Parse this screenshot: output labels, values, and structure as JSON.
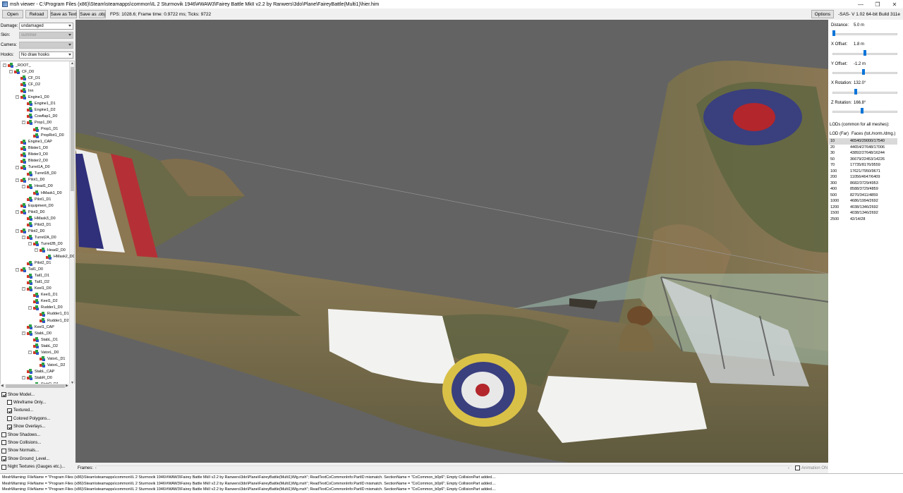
{
  "window": {
    "title": "msh viewer - C:\\Program Files (x86)\\Steam\\steamapps\\common\\IL 2 Sturmovik 1946\\#WAW3\\Fairey Battle MkII v2.2 by Ranwers\\3do\\Plane\\FaireyBattle(Multi1)\\hier.him",
    "min_icon": "minimize-icon",
    "max_icon": "maximize-icon",
    "close_icon": "close-icon"
  },
  "toolbar": {
    "open": "Open",
    "reload": "Reload",
    "save_text": "Save as Text",
    "save_obj": "Save as .obj",
    "stats": "FPS: 1028.6; Frame time: 0.9722 ms; Ticks: 9722",
    "options": "Options",
    "version": "-SAS-  V 1.02  64-bit  Build 311e"
  },
  "left": {
    "damage_label": "Damage:",
    "damage_value": "undamaged",
    "skin_label": "Skin:",
    "skin_value": "summer",
    "camera_label": "Camera:",
    "camera_value": "",
    "hooks_label": "Hooks:",
    "hooks_value": "No draw hooks"
  },
  "tree": [
    {
      "label": "_ROOT_",
      "depth": 0,
      "exp": "-"
    },
    {
      "label": "CF_D0",
      "depth": 1,
      "exp": "-"
    },
    {
      "label": "CF_D1",
      "depth": 2,
      "exp": ""
    },
    {
      "label": "CF_D2",
      "depth": 2,
      "exp": ""
    },
    {
      "label": "Inn",
      "depth": 2,
      "exp": ""
    },
    {
      "label": "Engine1_D0",
      "depth": 2,
      "exp": "-"
    },
    {
      "label": "Engine1_D1",
      "depth": 3,
      "exp": ""
    },
    {
      "label": "Engine1_D2",
      "depth": 3,
      "exp": ""
    },
    {
      "label": "Cowflap1_D0",
      "depth": 3,
      "exp": ""
    },
    {
      "label": "Prop1_D0",
      "depth": 3,
      "exp": "-"
    },
    {
      "label": "Prop1_D1",
      "depth": 4,
      "exp": ""
    },
    {
      "label": "PropRot1_D0",
      "depth": 4,
      "exp": ""
    },
    {
      "label": "Engine1_CAP",
      "depth": 2,
      "exp": ""
    },
    {
      "label": "Blister1_D0",
      "depth": 2,
      "exp": ""
    },
    {
      "label": "Blister3_D0",
      "depth": 2,
      "exp": ""
    },
    {
      "label": "Blister2_D0",
      "depth": 2,
      "exp": ""
    },
    {
      "label": "Turret1A_D0",
      "depth": 2,
      "exp": "-"
    },
    {
      "label": "Turret1B_D0",
      "depth": 3,
      "exp": ""
    },
    {
      "label": "Pilot1_D0",
      "depth": 2,
      "exp": "-"
    },
    {
      "label": "Head1_D0",
      "depth": 3,
      "exp": "-"
    },
    {
      "label": "HMask1_D0",
      "depth": 4,
      "exp": ""
    },
    {
      "label": "Pilot1_D1",
      "depth": 3,
      "exp": ""
    },
    {
      "label": "Equipment_D0",
      "depth": 2,
      "exp": ""
    },
    {
      "label": "Pilot3_D0",
      "depth": 2,
      "exp": "-"
    },
    {
      "label": "HMask3_D0",
      "depth": 3,
      "exp": ""
    },
    {
      "label": "Pilot3_D1",
      "depth": 3,
      "exp": ""
    },
    {
      "label": "Pilot2_D0",
      "depth": 2,
      "exp": "-"
    },
    {
      "label": "Turret2A_D0",
      "depth": 3,
      "exp": "-"
    },
    {
      "label": "Turret2B_D0",
      "depth": 4,
      "exp": "-"
    },
    {
      "label": "Head2_D0",
      "depth": 5,
      "exp": "-"
    },
    {
      "label": "HMask2_D0",
      "depth": 6,
      "exp": ""
    },
    {
      "label": "Pilot2_D1",
      "depth": 3,
      "exp": ""
    },
    {
      "label": "Tail1_D0",
      "depth": 2,
      "exp": "-"
    },
    {
      "label": "Tail1_D1",
      "depth": 3,
      "exp": ""
    },
    {
      "label": "Tail1_D2",
      "depth": 3,
      "exp": ""
    },
    {
      "label": "Keel1_D0",
      "depth": 3,
      "exp": "-"
    },
    {
      "label": "Keel1_D1",
      "depth": 4,
      "exp": ""
    },
    {
      "label": "Keel1_D2",
      "depth": 4,
      "exp": ""
    },
    {
      "label": "Rudder1_D0",
      "depth": 4,
      "exp": "-"
    },
    {
      "label": "Rudder1_D1",
      "depth": 5,
      "exp": ""
    },
    {
      "label": "Rudder1_D2",
      "depth": 5,
      "exp": ""
    },
    {
      "label": "Keel1_CAP",
      "depth": 3,
      "exp": ""
    },
    {
      "label": "StabL_D0",
      "depth": 3,
      "exp": "-"
    },
    {
      "label": "StabL_D1",
      "depth": 4,
      "exp": ""
    },
    {
      "label": "StabL_D2",
      "depth": 4,
      "exp": ""
    },
    {
      "label": "VatorL_D0",
      "depth": 4,
      "exp": "-"
    },
    {
      "label": "VatorL_D1",
      "depth": 5,
      "exp": ""
    },
    {
      "label": "VatorL_D2",
      "depth": 5,
      "exp": ""
    },
    {
      "label": "StabL_CAP",
      "depth": 3,
      "exp": ""
    },
    {
      "label": "StabR_D0",
      "depth": 3,
      "exp": "-"
    },
    {
      "label": "StabR_D1",
      "depth": 4,
      "exp": ""
    }
  ],
  "checks": [
    {
      "label": "Show Model...",
      "checked": true,
      "indent": 0
    },
    {
      "label": "Wireframe Only...",
      "checked": false,
      "indent": 1
    },
    {
      "label": "Textured...",
      "checked": true,
      "indent": 1
    },
    {
      "label": "Colored Polygons...",
      "checked": false,
      "indent": 1
    },
    {
      "label": "Show Overlays...",
      "checked": true,
      "indent": 1
    },
    {
      "label": "Show Shadows...",
      "checked": false,
      "indent": 0
    },
    {
      "label": "Show Collisions...",
      "checked": false,
      "indent": 0
    },
    {
      "label": "Show Normals...",
      "checked": false,
      "indent": 0
    },
    {
      "label": "Show Ground_Level...",
      "checked": true,
      "indent": 0
    },
    {
      "label": "Night Textures (Gauges etc.)...",
      "checked": false,
      "indent": 0
    }
  ],
  "right": {
    "sliders": [
      {
        "label": "Distance:",
        "value": "5.0 m",
        "fraction": 0.0
      },
      {
        "label": "X Offset:",
        "value": "1.8 m",
        "fraction": 0.5
      },
      {
        "label": "Y Offset:",
        "value": "-1.2 m",
        "fraction": 0.48
      },
      {
        "label": "X Rotation:",
        "value": "132.0°",
        "fraction": 0.35
      },
      {
        "label": "Z Rotation:",
        "value": "166.8°",
        "fraction": 0.45
      }
    ],
    "lods_title": "LODs (common for all meshes):",
    "lod_col1": "LOD (Far)",
    "lod_col2": "Faces (tot./norm./dmg.)",
    "lods": [
      {
        "lod": "10",
        "faces": "46540/29000/17540",
        "selected": true
      },
      {
        "lod": "20",
        "faces": "44654/27648/17006",
        "selected": false
      },
      {
        "lod": "30",
        "faces": "43892/27648/16244",
        "selected": false
      },
      {
        "lod": "50",
        "faces": "36679/22453/14226",
        "selected": false
      },
      {
        "lod": "70",
        "faces": "17735/8176/9559",
        "selected": false
      },
      {
        "lod": "100",
        "faces": "17621/7950/9671",
        "selected": false
      },
      {
        "lod": "200",
        "faces": "11056/4647/6409",
        "selected": false
      },
      {
        "lod": "300",
        "faces": "8682/3729/4953",
        "selected": false
      },
      {
        "lod": "400",
        "faces": "8588/3729/4859",
        "selected": false
      },
      {
        "lod": "500",
        "faces": "8270/3411/4859",
        "selected": false
      },
      {
        "lod": "1000",
        "faces": "4686/1994/2692",
        "selected": false
      },
      {
        "lod": "1200",
        "faces": "4038/1346/2692",
        "selected": false
      },
      {
        "lod": "1500",
        "faces": "4038/1346/2692",
        "selected": false
      },
      {
        "lod": "2500",
        "faces": "42/14/28",
        "selected": false
      }
    ]
  },
  "frames": {
    "label": "Frames:",
    "animation_label": "Animation ON"
  },
  "log": [
    "MeshWarning: FileName = \"Program Files (x86)\\Steam\\steamapps\\common\\IL 2 Sturmovik 1946\\#WAW3\\Fairey Battle MkII v2.2 by Ranwers\\3do\\Plane\\FaireyBattle(Multi1)\\Mg.msh\"; ReadTextCoCommonInfo:PartID mismatch. SectionName = \"CoCommon_b0p6\"; Empty CollisionPart added....",
    "MeshWarning: FileName = \"Program Files (x86)\\Steam\\steamapps\\common\\IL 2 Sturmovik 1946\\#WAW3\\Fairey Battle MkII v2.2 by Ranwers\\3do\\Plane\\FaireyBattle(Multi1)\\Mg.msh\"; ReadTextCoCommonInfo:PartID mismatch. SectionName = \"CoCommon_b0p6\"; Empty CollisionPart added....",
    "MeshWarning: FileName = \"Program Files (x86)\\Steam\\steamapps\\common\\IL 2 Sturmovik 1946\\#WAW3\\Fairey Battle MkII v2.2 by Ranwers\\3do\\Plane\\FaireyBattle(Multi1)\\Mg.msh\"; ReadTextCoCommonInfo:PartID mismatch. SectionName = \"CoCommon_b0p6\"; Empty CollisionPart added...."
  ],
  "colors": {
    "viewport_bg": "#636363",
    "slider_thumb": "#0a74d8",
    "camo_green": "#6b6a48",
    "camo_brown": "#8a7450",
    "roundel_blue": "#3a3f7e",
    "roundel_red": "#b3262b",
    "roundel_yellow": "#d9c148"
  }
}
